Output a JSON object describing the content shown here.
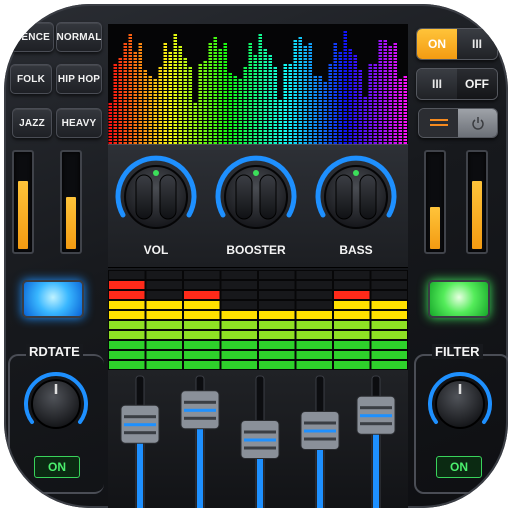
{
  "presets": {
    "dance": "DENCE",
    "normal": "NORMAL",
    "folk": "FOLK",
    "hiphop": "HIP HOP",
    "jazz": "JAZZ",
    "heavy": "HEAVY"
  },
  "knobs": {
    "vol": "VOL",
    "booster": "BOOSTER",
    "bass": "BASS"
  },
  "toggles": {
    "on_label": "ON",
    "off_label": "OFF",
    "bars": "III"
  },
  "rotate": {
    "label": "RDTATE",
    "state": "ON"
  },
  "filter": {
    "label": "FILTER",
    "state": "ON"
  },
  "meters": {
    "left_1": 0.72,
    "left_2": 0.55,
    "right_1": 0.45,
    "right_2": 0.72
  },
  "sliders": [
    0.28,
    0.12,
    0.45,
    0.35,
    0.18
  ],
  "colors": {
    "accent_blue": "#1e90ff",
    "accent_orange": "#f7a21b",
    "led_green": "#3ce05a"
  }
}
